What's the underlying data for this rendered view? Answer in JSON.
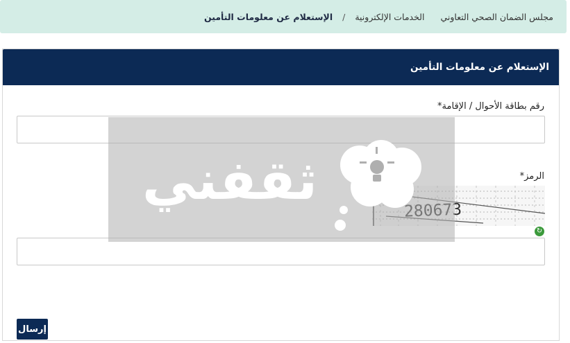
{
  "breadcrumb": {
    "items": [
      "مجلس الضمان الصحي التعاوني",
      "الخدمات الإلكترونية",
      "الإستعلام عن معلومات التأمين"
    ],
    "separator": "/"
  },
  "panel": {
    "title": "الإستعلام عن معلومات التأمين"
  },
  "form": {
    "id_label": "رقم بطاقة الأحوال / الإقامة*",
    "id_value": "",
    "captcha_label": "الرمز*",
    "captcha_text": "280673",
    "captcha_value": "",
    "submit_label": "إرسال",
    "refresh_icon": "refresh-icon"
  },
  "watermark": {
    "text": "ثقفني"
  },
  "colors": {
    "breadcrumb_bg": "#d4ede6",
    "header_bg": "#0c2a55",
    "button_bg": "#0c2a55",
    "watermark_bg": "#afafaf",
    "refresh_icon": "#3c9a3c"
  }
}
